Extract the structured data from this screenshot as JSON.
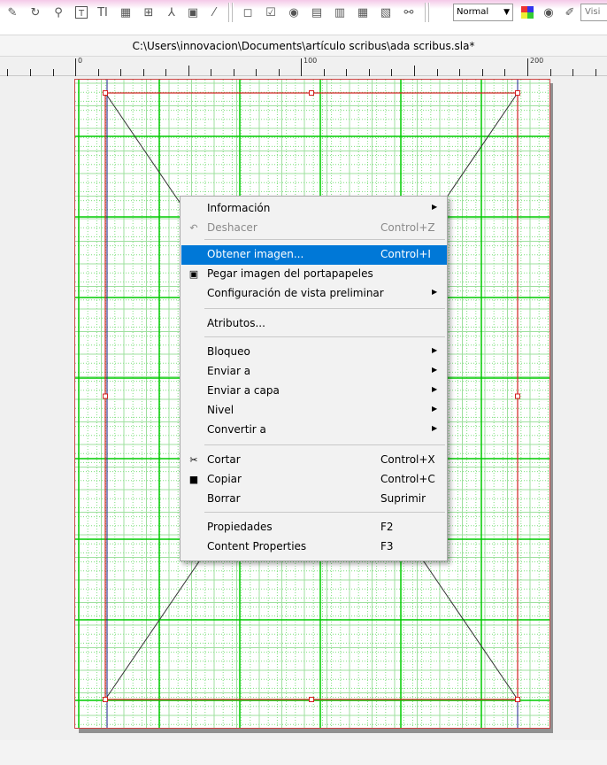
{
  "toolbar": {
    "icons": [
      "edit-contents-icon",
      "link-icon",
      "zoom-icon",
      "text-frame-icon",
      "text-edit-icon",
      "table-icon",
      "grid-icon",
      "measure-icon",
      "color-picker-icon",
      "eyedropper-icon",
      "pdf-push-button-icon",
      "pdf-checkbox-icon",
      "pdf-radio-icon",
      "pdf-textfield-icon",
      "pdf-combo-icon",
      "pdf-list-icon",
      "pdf-annotation-icon",
      "pdf-link-icon"
    ],
    "mode_select": "Normal",
    "visual_field": "Visi"
  },
  "window": {
    "title": "C:\\Users\\innovacion\\Documents\\artículo scribus\\ada scribus.sla*"
  },
  "ruler": {
    "labels": [
      "0",
      "100",
      "200"
    ]
  },
  "context_menu": {
    "items": [
      {
        "label": "Información",
        "shortcut": "",
        "submenu": true,
        "disabled": false,
        "highlighted": false,
        "icon": ""
      },
      {
        "label": "Deshacer",
        "shortcut": "Control+Z",
        "submenu": false,
        "disabled": true,
        "highlighted": false,
        "icon": "undo-icon"
      },
      {
        "label": "Obtener imagen...",
        "shortcut": "Control+I",
        "submenu": false,
        "disabled": false,
        "highlighted": true,
        "icon": ""
      },
      {
        "label": "Pegar imagen del portapapeles",
        "shortcut": "",
        "submenu": false,
        "disabled": false,
        "highlighted": false,
        "icon": "paste-icon"
      },
      {
        "label": "Configuración de vista preliminar",
        "shortcut": "",
        "submenu": true,
        "disabled": false,
        "highlighted": false,
        "icon": ""
      },
      {
        "label": "Atributos...",
        "shortcut": "",
        "submenu": false,
        "disabled": false,
        "highlighted": false,
        "icon": ""
      },
      {
        "label": "Bloqueo",
        "shortcut": "",
        "submenu": true,
        "disabled": false,
        "highlighted": false,
        "icon": ""
      },
      {
        "label": "Enviar a",
        "shortcut": "",
        "submenu": true,
        "disabled": false,
        "highlighted": false,
        "icon": ""
      },
      {
        "label": "Enviar a capa",
        "shortcut": "",
        "submenu": true,
        "disabled": false,
        "highlighted": false,
        "icon": ""
      },
      {
        "label": "Nivel",
        "shortcut": "",
        "submenu": true,
        "disabled": false,
        "highlighted": false,
        "icon": ""
      },
      {
        "label": "Convertir a",
        "shortcut": "",
        "submenu": true,
        "disabled": false,
        "highlighted": false,
        "icon": ""
      },
      {
        "label": "Cortar",
        "shortcut": "Control+X",
        "submenu": false,
        "disabled": false,
        "highlighted": false,
        "icon": "cut-icon"
      },
      {
        "label": "Copiar",
        "shortcut": "Control+C",
        "submenu": false,
        "disabled": false,
        "highlighted": false,
        "icon": "copy-icon"
      },
      {
        "label": "Borrar",
        "shortcut": "Suprimir",
        "submenu": false,
        "disabled": false,
        "highlighted": false,
        "icon": ""
      },
      {
        "label": "Propiedades",
        "shortcut": "F2",
        "submenu": false,
        "disabled": false,
        "highlighted": false,
        "icon": ""
      },
      {
        "label": "Content Properties",
        "shortcut": "F3",
        "submenu": false,
        "disabled": false,
        "highlighted": false,
        "icon": ""
      }
    ]
  },
  "colors": {
    "highlight": "#0078d7",
    "frame_border": "#d32020",
    "margin_guide": "#1e1e8c",
    "grid_major": "#00cc00",
    "grid_minor": "#7ddf7d"
  }
}
